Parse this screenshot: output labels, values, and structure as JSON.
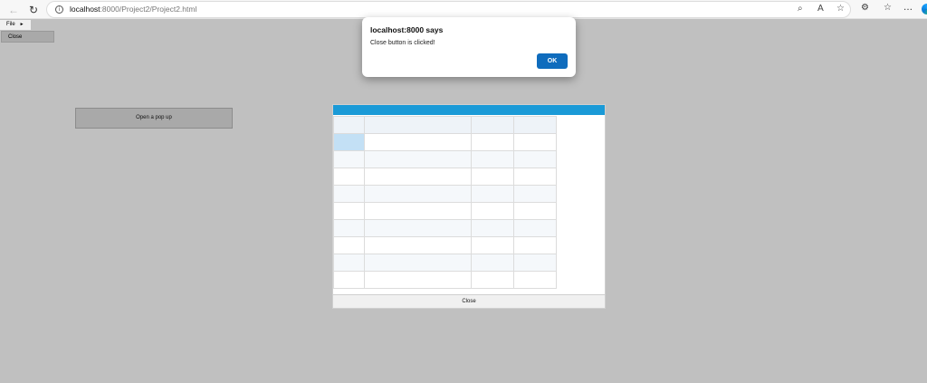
{
  "browser": {
    "url_host": "localhost",
    "url_path": ":8000/Project2/Project2.html",
    "icons": [
      "back-arrow-icon",
      "refresh-icon",
      "info-icon",
      "zoom-icon",
      "read-aloud-icon",
      "favorite-star-icon",
      "extensions-icon",
      "favorites-icon",
      "more-icon",
      "edge-logo-icon"
    ]
  },
  "menu": {
    "file_label": "File",
    "file_arrow": "►",
    "close_item_label": "Close"
  },
  "main": {
    "open_popup_label": "Open a pop up"
  },
  "popup": {
    "header_color": "#1a9ad7",
    "close_label": "Close",
    "grid": {
      "columns": 4,
      "rows": 10
    }
  },
  "alert": {
    "title": "localhost:8000 says",
    "message": "Close button is clicked!",
    "ok_label": "OK"
  }
}
